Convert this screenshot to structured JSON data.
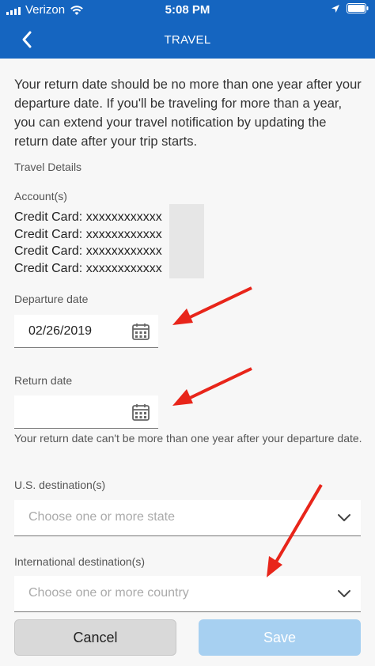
{
  "status_bar": {
    "carrier": "Verizon",
    "time": "5:08 PM"
  },
  "nav": {
    "title": "TRAVEL"
  },
  "intro_text": "Your return date should be no more than one year after your departure date. If you'll be traveling for more than a year, you can extend your travel notification by updating the return date after your trip starts.",
  "travel_details_label": "Travel Details",
  "accounts_label": "Account(s)",
  "accounts": [
    "Credit Card: xxxxxxxxxxxx",
    "Credit Card: xxxxxxxxxxxx",
    "Credit Card: xxxxxxxxxxxx",
    "Credit Card: xxxxxxxxxxxx"
  ],
  "departure": {
    "label": "Departure date",
    "value": "02/26/2019"
  },
  "return": {
    "label": "Return date",
    "value": "",
    "helper": "Your return date can't be more than one year after your departure date."
  },
  "us_destination": {
    "label": "U.S. destination(s)",
    "placeholder": "Choose one or more state"
  },
  "intl_destination": {
    "label": "International destination(s)",
    "placeholder": "Choose one or more country"
  },
  "buttons": {
    "cancel": "Cancel",
    "save": "Save"
  },
  "colors": {
    "header": "#1565c0",
    "annotation_arrow": "#e8251a",
    "save_disabled": "#a7d0f1"
  }
}
